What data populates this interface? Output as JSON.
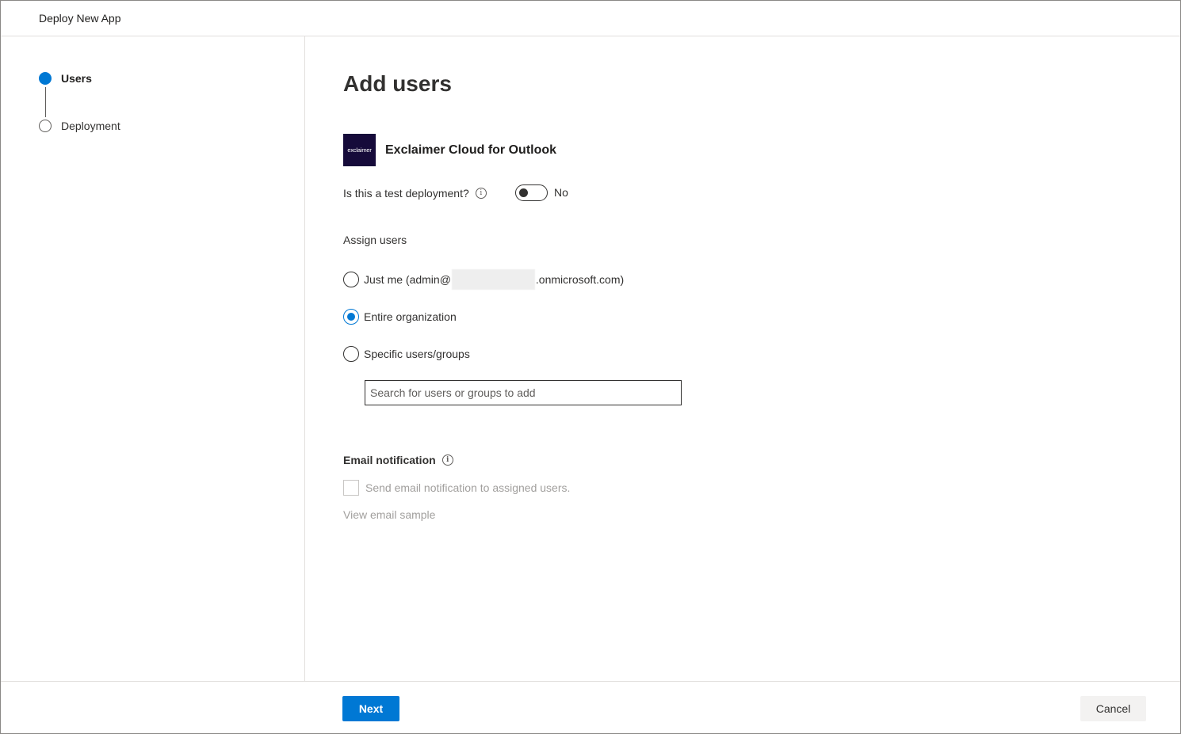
{
  "header": {
    "title": "Deploy New App"
  },
  "steps": [
    {
      "label": "Users",
      "state": "active"
    },
    {
      "label": "Deployment",
      "state": "inactive"
    }
  ],
  "main": {
    "title": "Add users",
    "app": {
      "logo_text": "exclaimer",
      "name": "Exclaimer Cloud for Outlook"
    },
    "test_deployment": {
      "label": "Is this a test deployment?",
      "toggle_on": false,
      "toggle_text": "No"
    },
    "assign": {
      "label": "Assign users",
      "options": [
        {
          "label_prefix": "Just me (admin@",
          "label_suffix": ".onmicrosoft.com)",
          "checked": false
        },
        {
          "label": "Entire organization",
          "checked": true
        },
        {
          "label": "Specific users/groups",
          "checked": false
        }
      ],
      "search_placeholder": "Search for users or groups to add"
    },
    "email_notification": {
      "label": "Email notification",
      "checkbox_label": "Send email notification to assigned users.",
      "checked": false,
      "view_sample": "View email sample"
    }
  },
  "footer": {
    "next_label": "Next",
    "cancel_label": "Cancel"
  },
  "colors": {
    "accent": "#0078d4",
    "logo_bg": "#160b3a"
  }
}
